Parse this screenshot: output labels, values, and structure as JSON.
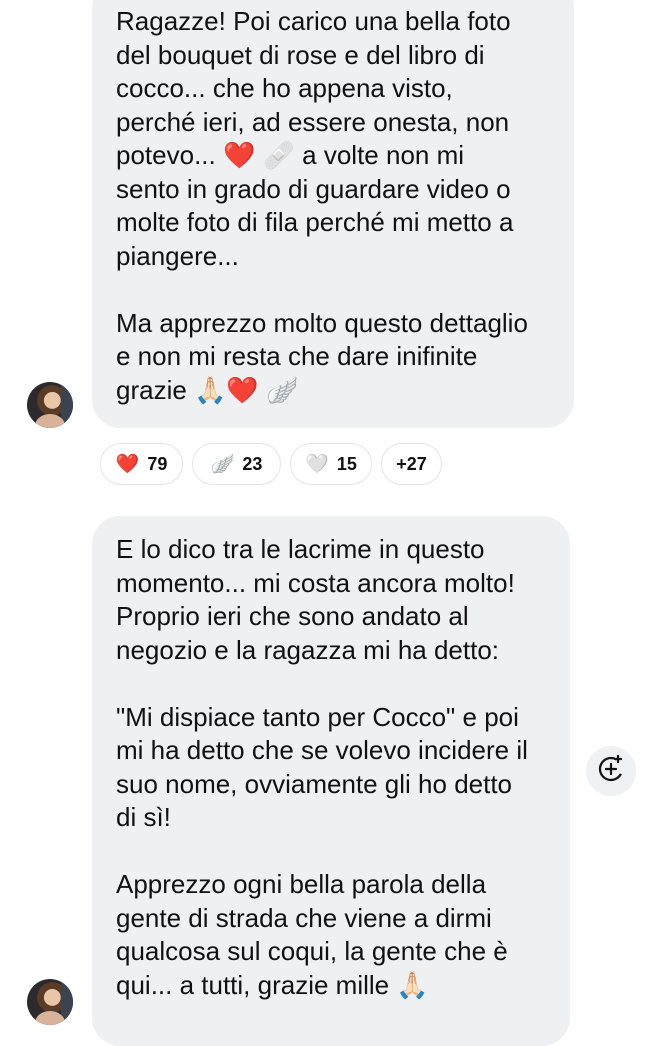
{
  "message1": {
    "paragraph1": "Ragazze! Poi carico una bella foto\ndel bouquet di rose e del libro di\ncocco... che ho appena visto,\nperché ieri, ad essere onesta, non\npotevo... ❤️ 🩹 a volte non mi\nsento in grado di guardare video o\nmolte foto di fila perché mi metto a\npiangere...",
    "paragraph2": "Ma apprezzo molto questo dettaglio\ne non mi resta che dare inifinite\ngrazie 🙏🏻❤️ 🪽"
  },
  "reactions": [
    {
      "emoji": "❤️",
      "count": "79"
    },
    {
      "emoji": "🪽",
      "count": "23"
    },
    {
      "emoji": "🤍",
      "count": "15"
    },
    {
      "emoji": "",
      "count": "+27"
    }
  ],
  "message2": {
    "paragraph1": "E lo dico tra le lacrime in questo\nmomento... mi costa ancora molto!\nProprio ieri che sono andato al\nnegozio e la ragazza mi ha detto:",
    "paragraph2": "\"Mi dispiace tanto per Cocco\" e poi\nmi ha detto che se volevo incidere il\nsuo nome, ovviamente gli ho detto\ndi sì!",
    "paragraph3": "Apprezzo ogni bella parola della\ngente di strada che viene a dirmi\nqualcosa sul coqui, la gente che è\nqui... a tutti, grazie mille 🙏🏻"
  },
  "icons": {
    "add_reaction": "add-reaction-icon",
    "avatar": "avatar"
  }
}
